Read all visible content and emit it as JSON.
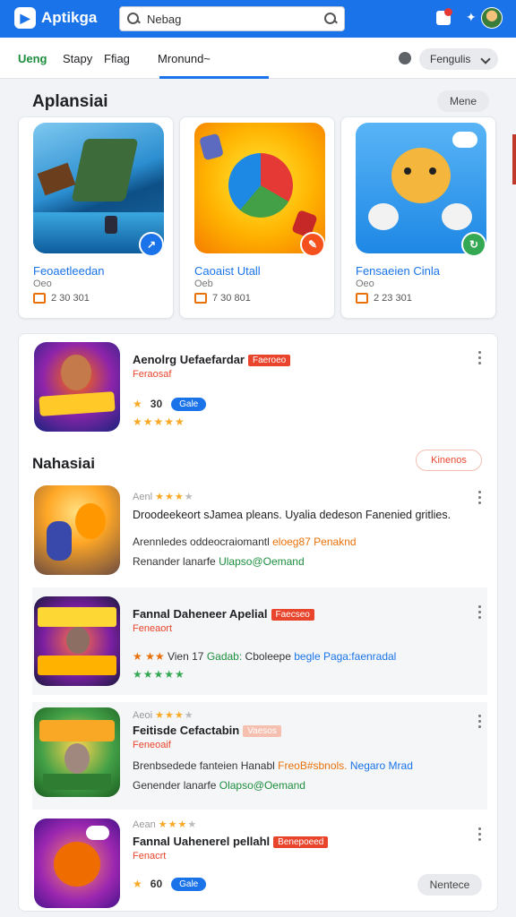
{
  "header": {
    "app_name": "Aptikga",
    "search_value": "Nebag",
    "colors": {
      "primary": "#1a73e8",
      "accent_green": "#1e8e3e",
      "accent_red": "#e8452c"
    }
  },
  "tabs": {
    "items": [
      "Ueng",
      "Stapy",
      "Ffiag",
      "Mronund~"
    ],
    "active_index": 0,
    "filter_label": "Fengulis"
  },
  "featured": {
    "title": "Aplansiai",
    "more_label": "Mene",
    "cards": [
      {
        "name": "Feoaetleedan",
        "sub": "Oeo",
        "meta": "2 30 301",
        "badge_icon": "share-icon",
        "badge_color": "#1a73e8"
      },
      {
        "name": "Caoaist Utall",
        "sub": "Oeb",
        "meta": "7 30 801",
        "badge_icon": "edit-icon",
        "badge_color": "#f4511e"
      },
      {
        "name": "Fensaeien Cinla",
        "sub": "Oeo",
        "meta": "2 23 301",
        "badge_icon": "refresh-icon",
        "badge_color": "#34a853"
      }
    ]
  },
  "top_item": {
    "title": "Aenolrg Uefaefardar",
    "tag": "Faeroeo",
    "sub": "Feraosaf",
    "rating": "30",
    "pill": "Gale"
  },
  "list_section": {
    "title": "Nahasiai",
    "button_label": "Kinenos",
    "bottom_button": "Nentece"
  },
  "list_items": [
    {
      "rating_text": "Aenl",
      "desc": "Droodeekeort sJamea pleans. Uyalia dedeson Fanenied gritlies.",
      "line1_a": "Arennledes oddeocraiomantl",
      "line1_b": "eloeg87",
      "line1_c": "Penaknd",
      "line2_a": "Renander lanarfe",
      "line2_b": "Ulapso@Oemand"
    },
    {
      "title": "Fannal Daheneer Apelial",
      "tag": "Faecseo",
      "sub": "Feneaort",
      "stars_text": "Vien",
      "num": "17",
      "line_b": "Gadab:",
      "line_c": "Cboleepe",
      "line_d": "begle Paga:faenradal"
    },
    {
      "rating_text": "Aeoi",
      "title": "Feitisde Cefactabin",
      "tag": "Vaesos",
      "sub": "Feneoaif",
      "line1_a": "Brenbsedede fanteien Hanabl",
      "line1_b": "FreoB#sbnols.",
      "line1_c": "Negaro Mrad",
      "line2_a": "Genender lanarfe",
      "line2_b": "Olapso@Oemand"
    },
    {
      "rating_text": "Aean",
      "title": "Fannal Uahenerel pellahl",
      "tag": "Benepoeed",
      "sub": "Fenacrt",
      "num": "60",
      "pill": "Gale"
    }
  ]
}
